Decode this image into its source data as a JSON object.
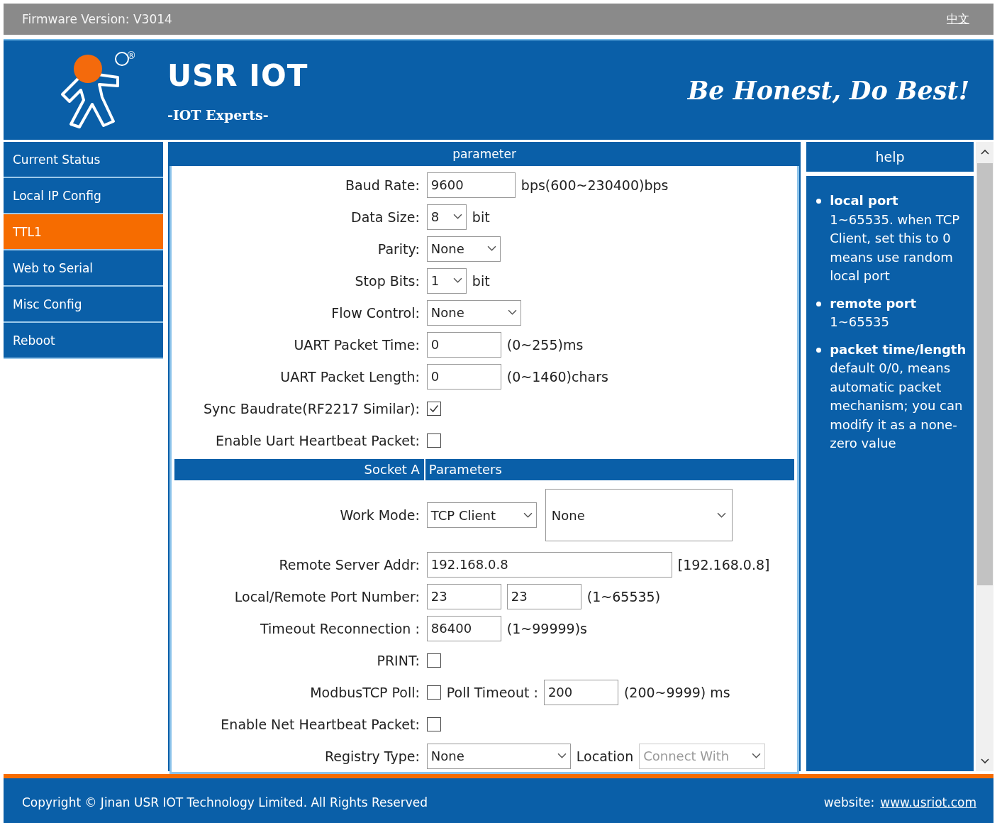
{
  "top_bar": {
    "firmware": "Firmware Version: V3014",
    "language_link": "中文"
  },
  "header": {
    "logo_mark": "®",
    "brand": "USR IOT",
    "tagline": "-IOT Experts-",
    "slogan": "Be Honest, Do Best!"
  },
  "sidebar": {
    "items": [
      {
        "label": "Current Status",
        "selected": false
      },
      {
        "label": "Local IP Config",
        "selected": false
      },
      {
        "label": "TTL1",
        "selected": true
      },
      {
        "label": "Web to Serial",
        "selected": false
      },
      {
        "label": "Misc Config",
        "selected": false
      },
      {
        "label": "Reboot",
        "selected": false
      }
    ]
  },
  "parameter_panel": {
    "title": "parameter",
    "rows": [
      {
        "kind": "field",
        "label": "Baud Rate:",
        "controls": [
          {
            "kind": "input",
            "value": "9600"
          },
          {
            "kind": "text",
            "text": "bps(600~230400)bps"
          }
        ]
      },
      {
        "kind": "field",
        "label": "Data Size:",
        "controls": [
          {
            "kind": "select",
            "value": "8"
          },
          {
            "kind": "text",
            "text": "bit"
          }
        ]
      },
      {
        "kind": "field",
        "label": "Parity:",
        "controls": [
          {
            "kind": "select",
            "value": "None"
          }
        ]
      },
      {
        "kind": "field",
        "label": "Stop Bits:",
        "controls": [
          {
            "kind": "select",
            "value": "1"
          },
          {
            "kind": "text",
            "text": "bit"
          }
        ]
      },
      {
        "kind": "field",
        "label": "Flow Control:",
        "controls": [
          {
            "kind": "select",
            "value": "None"
          }
        ]
      },
      {
        "kind": "field",
        "label": "UART Packet Time:",
        "controls": [
          {
            "kind": "input",
            "value": "0"
          },
          {
            "kind": "text",
            "text": "(0~255)ms"
          }
        ]
      },
      {
        "kind": "field",
        "label": "UART Packet Length:",
        "controls": [
          {
            "kind": "input",
            "value": "0"
          },
          {
            "kind": "text",
            "text": "(0~1460)chars"
          }
        ]
      },
      {
        "kind": "field",
        "label": "Sync Baudrate(RF2217 Similar):",
        "controls": [
          {
            "kind": "checkbox",
            "checked": true
          }
        ]
      },
      {
        "kind": "field",
        "label": "Enable Uart Heartbeat Packet:",
        "controls": [
          {
            "kind": "checkbox",
            "checked": false
          }
        ]
      },
      {
        "kind": "section",
        "label": "Socket A",
        "title": "Parameters"
      },
      {
        "kind": "field",
        "label": "Work Mode:",
        "controls": [
          {
            "kind": "select",
            "value": "TCP Client"
          },
          {
            "kind": "select",
            "value": "None"
          }
        ]
      },
      {
        "kind": "field",
        "label": "Remote Server Addr:",
        "controls": [
          {
            "kind": "input",
            "value": "192.168.0.8"
          },
          {
            "kind": "text",
            "text": "[192.168.0.8]"
          }
        ]
      },
      {
        "kind": "field",
        "label": "Local/Remote Port Number:",
        "controls": [
          {
            "kind": "input",
            "value": "23"
          },
          {
            "kind": "input",
            "value": "23"
          },
          {
            "kind": "text",
            "text": "(1~65535)"
          }
        ]
      },
      {
        "kind": "field",
        "label": "Timeout Reconnection :",
        "controls": [
          {
            "kind": "input",
            "value": "86400"
          },
          {
            "kind": "text",
            "text": "(1~99999)s"
          }
        ]
      },
      {
        "kind": "field",
        "label": "PRINT:",
        "controls": [
          {
            "kind": "checkbox",
            "checked": false
          }
        ]
      },
      {
        "kind": "field",
        "label": "ModbusTCP Poll:",
        "controls": [
          {
            "kind": "checkbox",
            "checked": false
          },
          {
            "kind": "text",
            "text": "Poll Timeout :"
          },
          {
            "kind": "input",
            "value": "200"
          },
          {
            "kind": "text",
            "text": "(200~9999) ms"
          }
        ]
      },
      {
        "kind": "field",
        "label": "Enable Net Heartbeat Packet:",
        "controls": [
          {
            "kind": "checkbox",
            "checked": false
          }
        ]
      },
      {
        "kind": "field",
        "label": "Registry Type:",
        "controls": [
          {
            "kind": "select",
            "value": "None"
          },
          {
            "kind": "text",
            "text": "Location"
          },
          {
            "kind": "select",
            "value": "Connect With",
            "disabled": true
          }
        ]
      }
    ]
  },
  "help_panel": {
    "title": "help",
    "items": [
      {
        "title": "local port",
        "text": "1~65535. when TCP Client, set this to 0 means use random local port"
      },
      {
        "title": "remote port",
        "text": "1~65535"
      },
      {
        "title": "packet time/length",
        "text": "default 0/0, means automatic packet mechanism; you can modify it as a none-zero value"
      }
    ]
  },
  "footer": {
    "copyright": "Copyright © Jinan USR IOT Technology Limited. All Rights Reserved",
    "website_label": "website:",
    "website_link": "www.usriot.com"
  }
}
